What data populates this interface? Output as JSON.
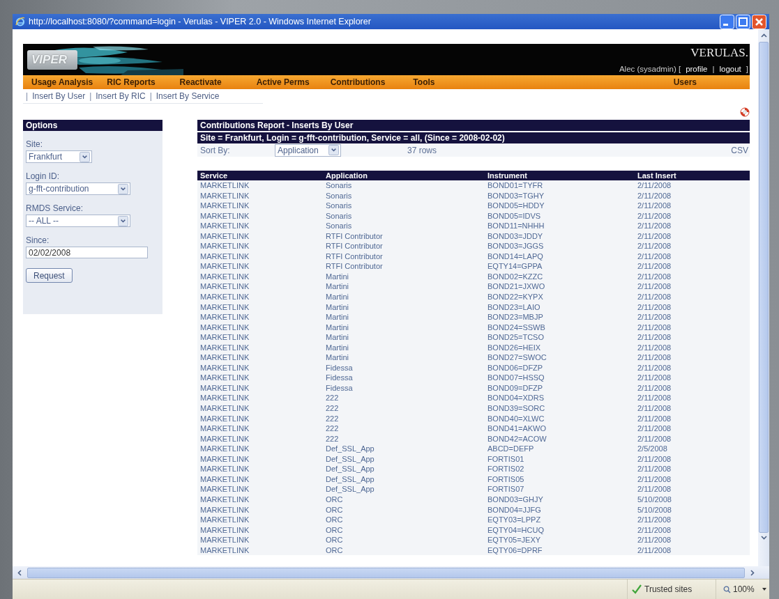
{
  "window": {
    "title": "http://localhost:8080/?command=login - Verulas - VIPER 2.0 - Windows Internet Explorer"
  },
  "banner": {
    "logo": "VIPER",
    "brand": "VERULAS.",
    "user_bar": [
      {
        "kind": "text",
        "label": "Alec (sysadmin) ["
      },
      {
        "kind": "link",
        "label": "profile"
      },
      {
        "kind": "text",
        "label": "|"
      },
      {
        "kind": "link",
        "label": "logout"
      },
      {
        "kind": "text",
        "label": "]"
      }
    ]
  },
  "nav": [
    {
      "label": "Usage Analysis"
    },
    {
      "label": "RIC Reports"
    },
    {
      "label": "Reactivate"
    },
    {
      "label": "Active Perms"
    },
    {
      "label": "Contributions"
    },
    {
      "label": "Tools"
    }
  ],
  "nav_right": {
    "label": "Users"
  },
  "subnav": {
    "separator": "|",
    "items": [
      "Insert By User",
      "Insert By RIC",
      "Insert By Service"
    ]
  },
  "options": {
    "title": "Options",
    "fields": [
      {
        "kind": "select",
        "label": "Site:",
        "value": "Frankfurt"
      },
      {
        "kind": "select",
        "label": "Login ID:",
        "value": "g-fft-contribution"
      },
      {
        "kind": "select",
        "label": "RMDS Service:",
        "value": "-- ALL --"
      },
      {
        "kind": "input",
        "label": "Since:",
        "value": "02/02/2008"
      }
    ],
    "button": "Request"
  },
  "report": {
    "title": "Contributions Report - Inserts By User",
    "filter": "Site = Frankfurt, Login = g-fft-contribution, Service = all, (Since = 2008-02-02)",
    "sort_label": "Sort By:",
    "sort_value": "Application",
    "row_count": "37 rows",
    "export": "CSV",
    "columns": [
      "Service",
      "Application",
      "Instrument",
      "Last Insert"
    ],
    "rows": [
      [
        "MARKETLINK",
        "Sonaris",
        "BOND01=TYFR",
        "2/11/2008"
      ],
      [
        "MARKETLINK",
        "Sonaris",
        "BOND03=TGHY",
        "2/11/2008"
      ],
      [
        "MARKETLINK",
        "Sonaris",
        "BOND05=HDDY",
        "2/11/2008"
      ],
      [
        "MARKETLINK",
        "Sonaris",
        "BOND05=IDVS",
        "2/11/2008"
      ],
      [
        "MARKETLINK",
        "Sonaris",
        "BOND11=NHHH",
        "2/11/2008"
      ],
      [
        "MARKETLINK",
        "RTFI Contributor",
        "BOND03=JDDY",
        "2/11/2008"
      ],
      [
        "MARKETLINK",
        "RTFI Contributor",
        "BOND03=JGGS",
        "2/11/2008"
      ],
      [
        "MARKETLINK",
        "RTFI Contributor",
        "BOND14=LAPQ",
        "2/11/2008"
      ],
      [
        "MARKETLINK",
        "RTFI Contributor",
        "EQTY14=GPPA",
        "2/11/2008"
      ],
      [
        "MARKETLINK",
        "Martini",
        "BOND02=KZZC",
        "2/11/2008"
      ],
      [
        "MARKETLINK",
        "Martini",
        "BOND21=JXWO",
        "2/11/2008"
      ],
      [
        "MARKETLINK",
        "Martini",
        "BOND22=KYPX",
        "2/11/2008"
      ],
      [
        "MARKETLINK",
        "Martini",
        "BOND23=LAIO",
        "2/11/2008"
      ],
      [
        "MARKETLINK",
        "Martini",
        "BOND23=MBJP",
        "2/11/2008"
      ],
      [
        "MARKETLINK",
        "Martini",
        "BOND24=SSWB",
        "2/11/2008"
      ],
      [
        "MARKETLINK",
        "Martini",
        "BOND25=TCSO",
        "2/11/2008"
      ],
      [
        "MARKETLINK",
        "Martini",
        "BOND26=HEIX",
        "2/11/2008"
      ],
      [
        "MARKETLINK",
        "Martini",
        "BOND27=SWOC",
        "2/11/2008"
      ],
      [
        "MARKETLINK",
        "Fidessa",
        "BOND06=DFZP",
        "2/11/2008"
      ],
      [
        "MARKETLINK",
        "Fidessa",
        "BOND07=HSSQ",
        "2/11/2008"
      ],
      [
        "MARKETLINK",
        "Fidessa",
        "BOND09=DFZP",
        "2/11/2008"
      ],
      [
        "MARKETLINK",
        "222",
        "BOND04=XDRS",
        "2/11/2008"
      ],
      [
        "MARKETLINK",
        "222",
        "BOND39=SORC",
        "2/11/2008"
      ],
      [
        "MARKETLINK",
        "222",
        "BOND40=XLWC",
        "2/11/2008"
      ],
      [
        "MARKETLINK",
        "222",
        "BOND41=AKWO",
        "2/11/2008"
      ],
      [
        "MARKETLINK",
        "222",
        "BOND42=ACOW",
        "2/11/2008"
      ],
      [
        "MARKETLINK",
        "Def_SSL_App",
        "ABCD=DEFP",
        "2/5/2008"
      ],
      [
        "MARKETLINK",
        "Def_SSL_App",
        "FORTIS01",
        "2/11/2008"
      ],
      [
        "MARKETLINK",
        "Def_SSL_App",
        "FORTIS02",
        "2/11/2008"
      ],
      [
        "MARKETLINK",
        "Def_SSL_App",
        "FORTIS05",
        "2/11/2008"
      ],
      [
        "MARKETLINK",
        "Def_SSL_App",
        "FORTIS07",
        "2/11/2008"
      ],
      [
        "MARKETLINK",
        "ORC",
        "BOND03=GHJY",
        "5/10/2008"
      ],
      [
        "MARKETLINK",
        "ORC",
        "BOND04=JJFG",
        "5/10/2008"
      ],
      [
        "MARKETLINK",
        "ORC",
        "EQTY03=LPPZ",
        "2/11/2008"
      ],
      [
        "MARKETLINK",
        "ORC",
        "EQTY04=HCUQ",
        "2/11/2008"
      ],
      [
        "MARKETLINK",
        "ORC",
        "EQTY05=JEXY",
        "2/11/2008"
      ],
      [
        "MARKETLINK",
        "ORC",
        "EQTY06=DPRF",
        "2/11/2008"
      ]
    ]
  },
  "status_bar": {
    "zone": "Trusted sites",
    "zoom": "100%"
  }
}
